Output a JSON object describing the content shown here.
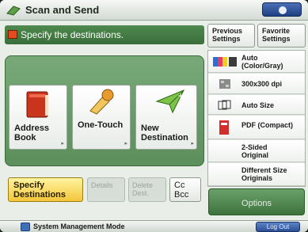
{
  "titlebar": {
    "title": "Scan and Send"
  },
  "header": {
    "text": "Specify the destinations."
  },
  "destinations": {
    "address_book": "Address\nBook",
    "one_touch": "One-Touch",
    "new_destination": "New\nDestination"
  },
  "bottom_buttons": {
    "specify": "Specify\nDestinations",
    "details": "Details",
    "delete_dest": "Delete\nDest.",
    "cc_bcc": "Cc\nBcc"
  },
  "tabs": {
    "previous": "Previous\nSettings",
    "favorite": "Favorite\nSettings"
  },
  "settings": {
    "color": "Auto\n(Color/Gray)",
    "resolution": "300x300 dpi",
    "size": "Auto Size",
    "format": "PDF (Compact)",
    "sided": "2-Sided\nOriginal",
    "diff_size": "Different Size\nOriginals"
  },
  "options_label": "Options",
  "footer": {
    "status": "System Management Mode",
    "logout": "Log Out"
  },
  "colors": {
    "header": "#3f763f",
    "panel": "#6e9e6e",
    "specify": "#f3c63a",
    "logout": "#2d4f94"
  }
}
